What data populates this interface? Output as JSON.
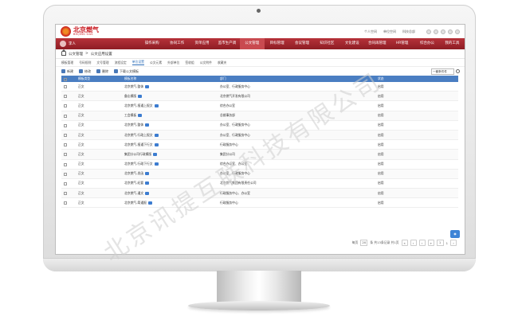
{
  "brand": {
    "name_cn": "北京燃气",
    "name_en": "BEIJING GAS"
  },
  "top_links": [
    "个人空间",
    "单位空间",
    "科技总部"
  ],
  "user": {
    "name": "李人"
  },
  "nav": [
    "操作采购",
    "协同工作",
    "资单应用",
    "监市生产调",
    "公文管理",
    "目标管理",
    "会议管理",
    "知识社区",
    "文化建设",
    "合同再管理",
    "HR管理",
    "综合办公",
    "我的工具"
  ],
  "breadcrumb": {
    "root": "公文管理",
    "sep": ">",
    "current": "公文应用设置"
  },
  "subtabs": [
    "模板管理",
    "号码规则",
    "文号管理",
    "流程设定",
    "单位设置",
    "公文元素",
    "外部单位",
    "签收组",
    "公文附件",
    "收藏夹"
  ],
  "toolbar": {
    "new": "新建",
    "edit": "修改",
    "delete": "删除",
    "download": "下载公文模板",
    "filter": "一套条件件"
  },
  "table": {
    "columns": [
      "",
      "模板类型",
      "模板名称",
      "部门",
      "状态"
    ],
    "rows": [
      {
        "type": "正文",
        "name": "北京燃气-整体",
        "dept": "办公室、行政服务中心",
        "status": "启用"
      },
      {
        "type": "正文",
        "name": "备忘模版",
        "dept": "北京燃气开发有限公司",
        "status": "启用"
      },
      {
        "type": "正文",
        "name": "北京燃气-报通上报文",
        "dept": "综合办公室",
        "status": "启用"
      },
      {
        "type": "正文",
        "name": "工会模板",
        "dept": "总裁事务部",
        "status": "启用"
      },
      {
        "type": "正文",
        "name": "北京燃气-整体",
        "dept": "办公室、行政服务中心",
        "status": "启用"
      },
      {
        "type": "正文",
        "name": "北京燃气-行政上报文",
        "dept": "办公室、行政服务中心",
        "status": "启用"
      },
      {
        "type": "正文",
        "name": "北京燃气-报通下行文",
        "dept": "行政服务中心",
        "status": "启用"
      },
      {
        "type": "正文",
        "name": "集团分公司行政模版",
        "dept": "集团分公司",
        "status": "启用"
      },
      {
        "type": "正文",
        "name": "北京燃气-行政下行文",
        "dept": "综合办公室、办公室",
        "status": "启用"
      },
      {
        "type": "正文",
        "name": "北京燃气-发函",
        "dept": "办公室、行政服务中心",
        "status": "启用"
      },
      {
        "type": "正文",
        "name": "北京燃气-纪要",
        "dept": "北京燃气集团有限责任公司",
        "status": "启用"
      },
      {
        "type": "正文",
        "name": "北京燃气-通文",
        "dept": "行政服务中心、办公室",
        "status": "启用"
      },
      {
        "type": "正文",
        "name": "北京燃气-简通报",
        "dept": "行政服务中心",
        "status": "启用"
      }
    ]
  },
  "pager": {
    "per_page_label": "每页",
    "per_page": "20",
    "summary": "条 共13条记录 共1页",
    "page": "1",
    "total": "1"
  },
  "watermark": "北京讯提互联科技有限公司"
}
